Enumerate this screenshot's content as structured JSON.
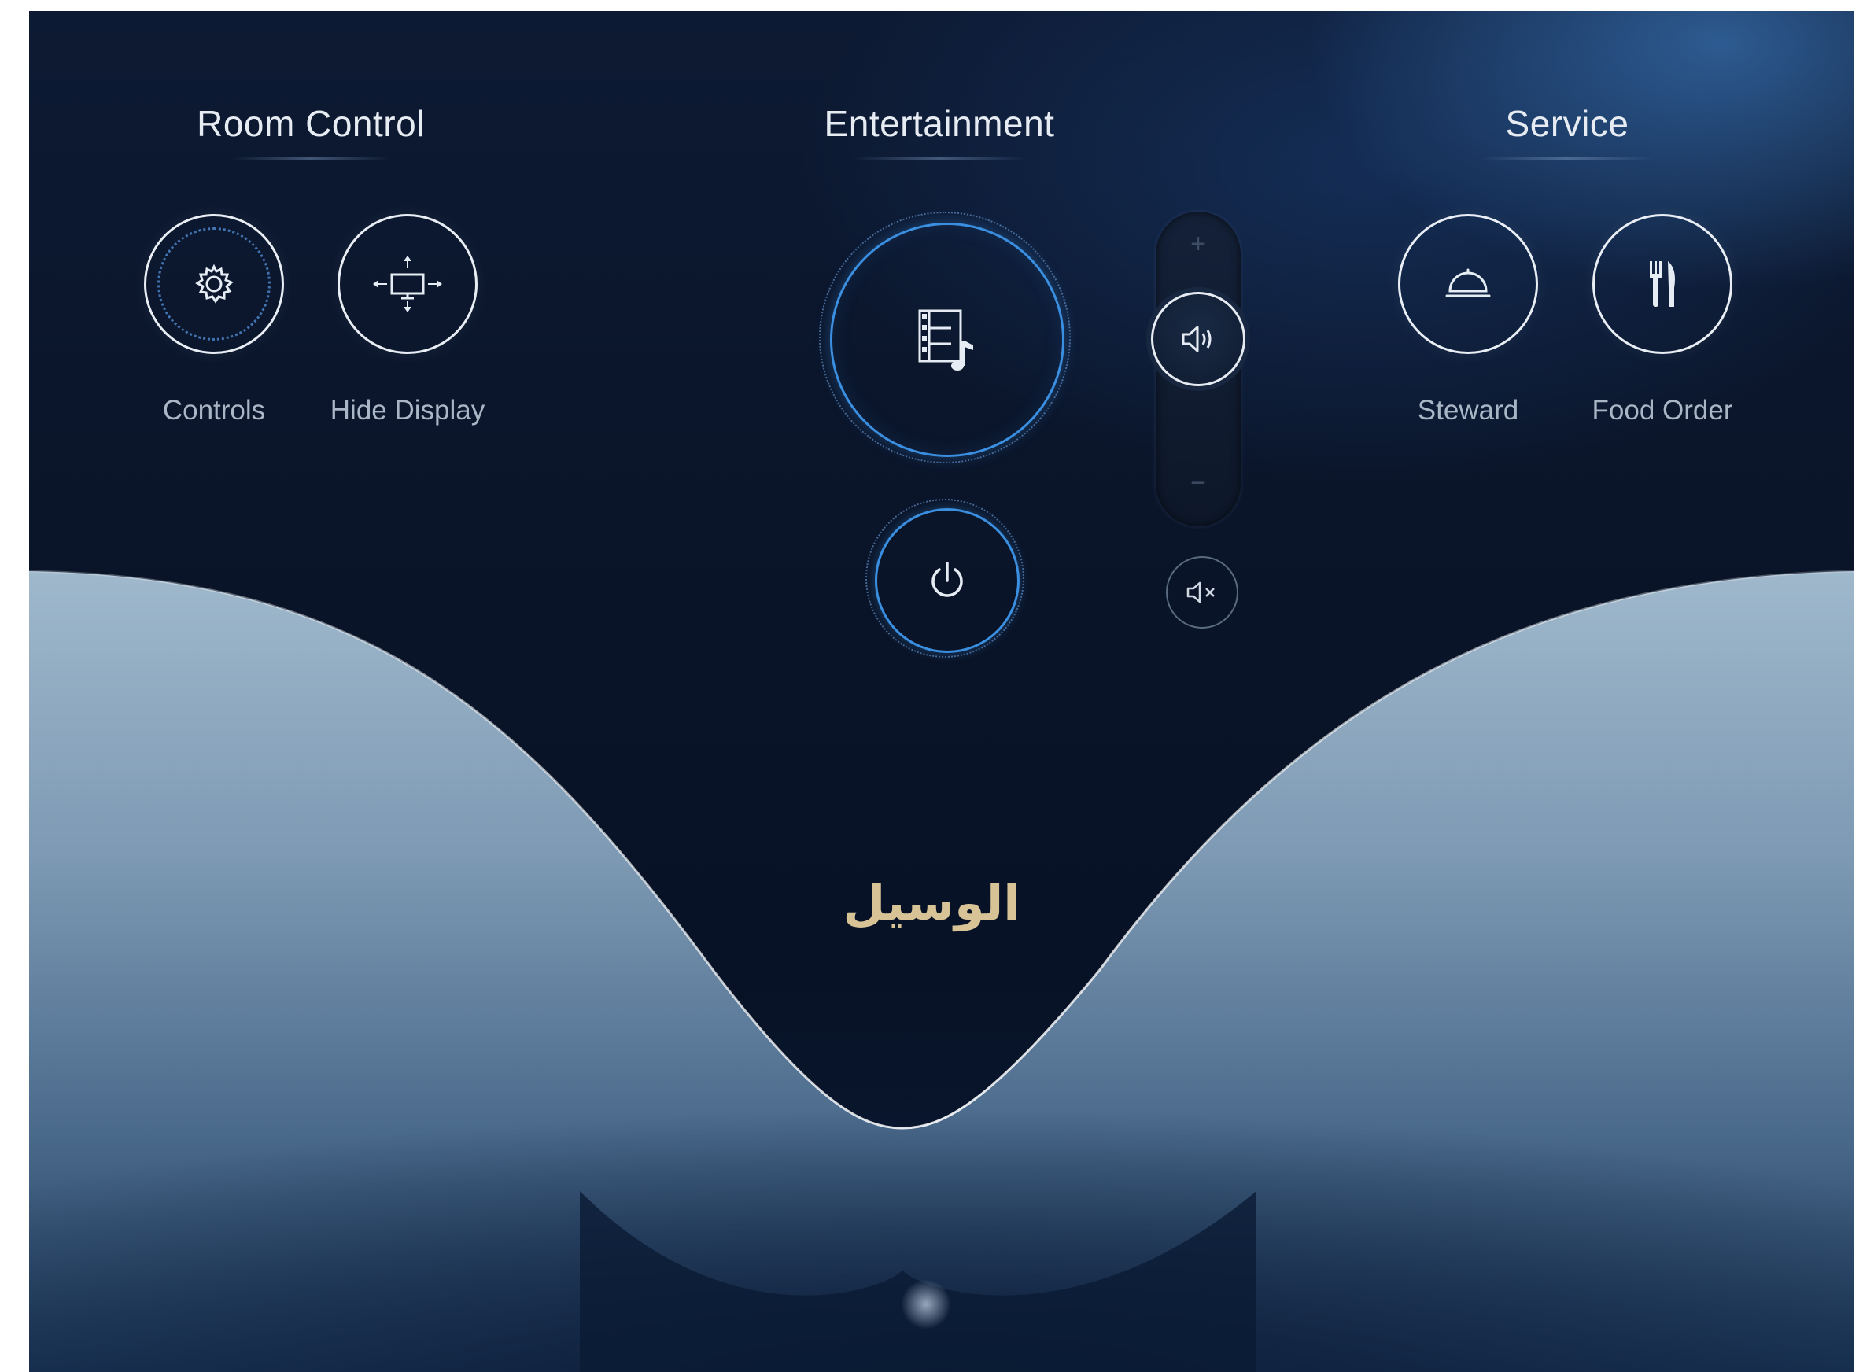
{
  "room_control": {
    "title": "Room Control",
    "buttons": [
      {
        "label": "Controls",
        "icon": "gear-icon"
      },
      {
        "label": "Hide Display",
        "icon": "display-move-icon"
      }
    ]
  },
  "entertainment": {
    "title": "Entertainment",
    "main_icon": "film-music-icon",
    "power_icon": "power-icon",
    "volume": {
      "plus": "+",
      "minus": "−",
      "knob_icon": "speaker-volume-icon",
      "mute_icon": "speaker-mute-icon"
    }
  },
  "service": {
    "title": "Service",
    "buttons": [
      {
        "label": "Steward",
        "icon": "cloche-icon"
      },
      {
        "label": "Food Order",
        "icon": "fork-knife-icon"
      }
    ]
  },
  "brand": {
    "text": "الوسيل"
  },
  "colors": {
    "accent_blue": "#3b8fe0",
    "brand_gold": "#d8c397",
    "background": "#0a1428"
  }
}
